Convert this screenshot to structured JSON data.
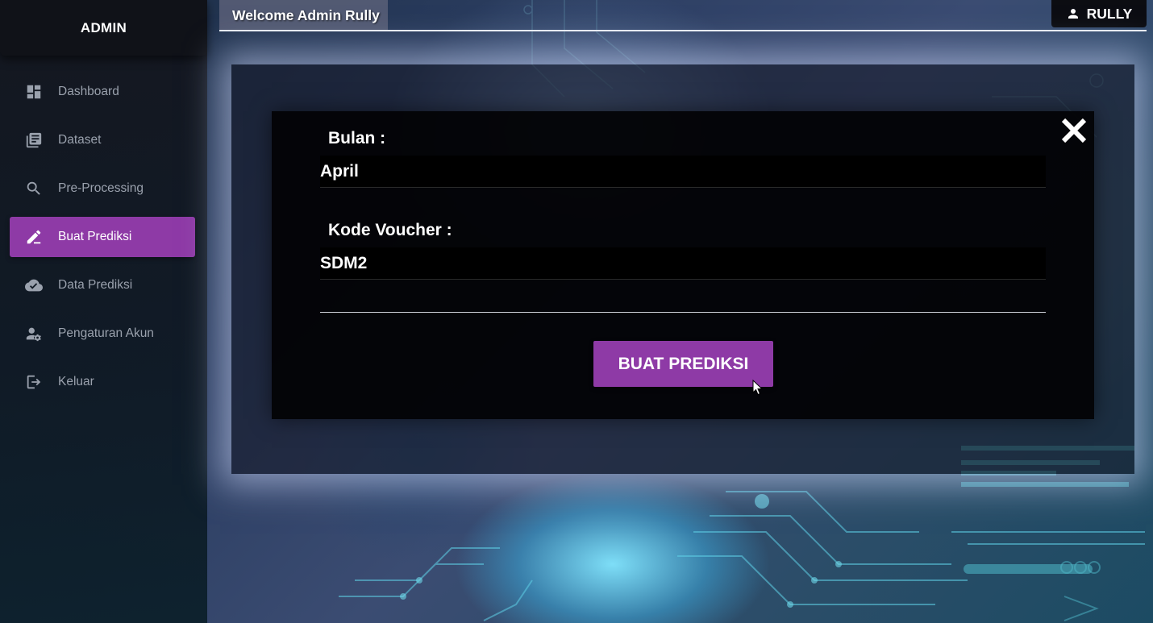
{
  "sidebar": {
    "brand": "ADMIN",
    "items": [
      {
        "label": "Dashboard",
        "icon": "dashboard-icon",
        "active": false
      },
      {
        "label": "Dataset",
        "icon": "library-books-icon",
        "active": false
      },
      {
        "label": "Pre-Processing",
        "icon": "search-icon",
        "active": false
      },
      {
        "label": "Buat Prediksi",
        "icon": "edit-pen-icon",
        "active": true
      },
      {
        "label": "Data Prediksi",
        "icon": "cloud-check-icon",
        "active": false
      },
      {
        "label": "Pengaturan Akun",
        "icon": "user-settings-icon",
        "active": false
      },
      {
        "label": "Keluar",
        "icon": "logout-icon",
        "active": false
      }
    ]
  },
  "topbar": {
    "welcome": "Welcome Admin Rully",
    "user_name": "RULLY",
    "user_icon": "person-icon"
  },
  "modal": {
    "close_icon": "close-icon",
    "bulan_label": "Bulan :",
    "bulan_value": "April",
    "kode_label": "Kode Voucher :",
    "kode_value": "SDM2",
    "submit_label": "BUAT PREDIKSI"
  },
  "colors": {
    "accent": "#8e3aa6",
    "sidebar_bg": "#14161e",
    "modal_bg": "#020204"
  }
}
